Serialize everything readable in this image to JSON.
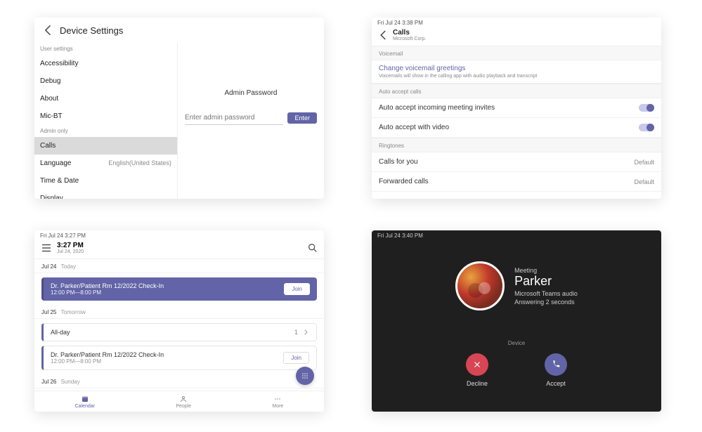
{
  "panel_a": {
    "title": "Device Settings",
    "group_user": "User settings",
    "items_user": [
      "Accessibility",
      "Debug",
      "About",
      "Mic-BT"
    ],
    "group_admin": "Admin only",
    "item_calls": "Calls",
    "item_language": "Language",
    "language_value": "English(United States)",
    "item_timedate": "Time & Date",
    "item_display": "Display",
    "right_title": "Admin Password",
    "placeholder": "Enter admin password",
    "enter_label": "Enter"
  },
  "panel_b": {
    "status": "Fri Jul 24  3:38 PM",
    "title": "Calls",
    "subtitle": "Microsoft Corp.",
    "sec_voicemail": "Voicemail",
    "link_greetings": "Change voicemail greetings",
    "note": "Voicemails will show in the calling app with audio playback and transcript",
    "sec_autoaccept": "Auto accept calls",
    "row_incoming": "Auto accept incoming meeting invites",
    "row_video": "Auto accept with video",
    "sec_ringtones": "Ringtones",
    "row_callsforyou": "Calls for you",
    "row_forwarded": "Forwarded calls",
    "default_label": "Default"
  },
  "panel_c": {
    "status": "Fri Jul 24  3:27 PM",
    "header_time": "3:27 PM",
    "header_date": "Jul 24, 2020",
    "day1": "Jul 24",
    "day1_dow": "Today",
    "event1_title": "Dr. Parker/Patient Rm 12/2022 Check-In",
    "event1_time": "12:00 PM—8:00 PM",
    "join": "Join",
    "day2": "Jul 25",
    "day2_dow": "Tomorrow",
    "allday": "All-day",
    "allday_count": "1",
    "event2_title": "Dr. Parker/Patient Rm 12/2022 Check-In",
    "event2_time": "12:00 PM—8:00 PM",
    "day3": "Jul 26",
    "day3_dow": "Sunday",
    "tab_calendar": "Calendar",
    "tab_people": "People",
    "tab_more": "More"
  },
  "panel_d": {
    "status": "Fri Jul 24  3:40 PM",
    "meeting": "Meeting",
    "name": "Parker",
    "audio": "Microsoft Teams audio",
    "answering": "Answering 2 seconds",
    "device": "Device",
    "decline": "Decline",
    "accept": "Accept"
  }
}
